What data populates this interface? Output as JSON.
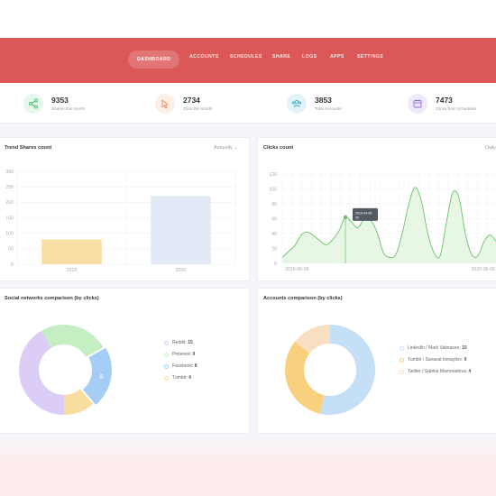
{
  "nav": {
    "items": [
      {
        "label": "DASHBOARD",
        "active": true
      },
      {
        "label": "ACCOUNTS"
      },
      {
        "label": "SCHEDULES"
      },
      {
        "label": "SHARE"
      },
      {
        "label": "LOGS"
      },
      {
        "label": "APPS"
      },
      {
        "label": "SETTINGS"
      }
    ],
    "accent": "#dc5757"
  },
  "stats": [
    {
      "value": "9353",
      "label": "Shares this month",
      "icon": "share-icon",
      "color": "#4ec27a",
      "bg": "#e6f7ec"
    },
    {
      "value": "2734",
      "label": "Click this month",
      "icon": "pointer-icon",
      "color": "#ec8a66",
      "bg": "#fdeee8"
    },
    {
      "value": "3853",
      "label": "Total Accounts",
      "icon": "users-icon",
      "color": "#3aa7c4",
      "bg": "#e2f4f8"
    },
    {
      "value": "7473",
      "label": "Clicks from Schedules",
      "icon": "calendar-icon",
      "color": "#8f6fd8",
      "bg": "#efeafb"
    }
  ],
  "trend_card": {
    "title": "Trend Shares count",
    "filter": "Annually"
  },
  "clicks_card": {
    "title": "Clicks count",
    "filter": "Daily",
    "tooltip_date": "2019-04-08",
    "tooltip_value": "42"
  },
  "social_card": {
    "title": "Social networks comparison (by clicks)"
  },
  "accounts_card": {
    "title": "Accounts comparison (by clicks)"
  },
  "chart_data": [
    {
      "type": "bar",
      "title": "Trend Shares count",
      "categories": [
        "2019",
        "2020"
      ],
      "values": [
        80,
        220
      ],
      "colors": [
        "#f8dea4",
        "#e3e9f7"
      ],
      "yticks": [
        0,
        50,
        100,
        150,
        200,
        250,
        300
      ],
      "ylim": [
        0,
        300
      ],
      "grid": true
    },
    {
      "type": "area",
      "title": "Clicks count",
      "x_start_label": "2019-06-06",
      "x_end_label": "2020-06-06",
      "yticks": [
        0,
        20,
        40,
        60,
        80,
        100,
        120
      ],
      "ylim": [
        0,
        120
      ],
      "values": [
        8,
        16,
        24,
        38,
        42,
        37,
        30,
        25,
        32,
        44,
        62,
        55,
        48,
        60,
        58,
        42,
        15,
        8,
        12,
        40,
        78,
        102,
        85,
        42,
        15,
        10,
        55,
        95,
        88,
        40,
        12,
        10,
        30,
        38,
        28
      ],
      "color": "#6cc16c",
      "fill": "#e8f6e6",
      "grid": true
    },
    {
      "type": "pie",
      "title": "Social networks comparison (by clicks)",
      "donut": true,
      "slices": [
        {
          "name": "Reddit",
          "value": 15,
          "color": "#dccdf7"
        },
        {
          "name": "Pinterest",
          "value": 9,
          "color": "#c5efc3"
        },
        {
          "name": "Facebook",
          "value": 8,
          "color": "#a5cdf5"
        },
        {
          "name": "Tumblr",
          "value": 4,
          "color": "#f8dca0"
        }
      ],
      "legend": "right"
    },
    {
      "type": "pie",
      "title": "Accounts comparison (by clicks)",
      "donut": true,
      "slices": [
        {
          "name": "LinkedIn / Mark Valmasen",
          "value": 15,
          "color": "#c5dff7"
        },
        {
          "name": "Tumblr / Savavat Ismayilov",
          "value": 9,
          "color": "#f8d07e"
        },
        {
          "name": "Twitter / Sabina Mammadova",
          "value": 4,
          "color": "#f9dfc1"
        }
      ],
      "legend": "right"
    }
  ]
}
